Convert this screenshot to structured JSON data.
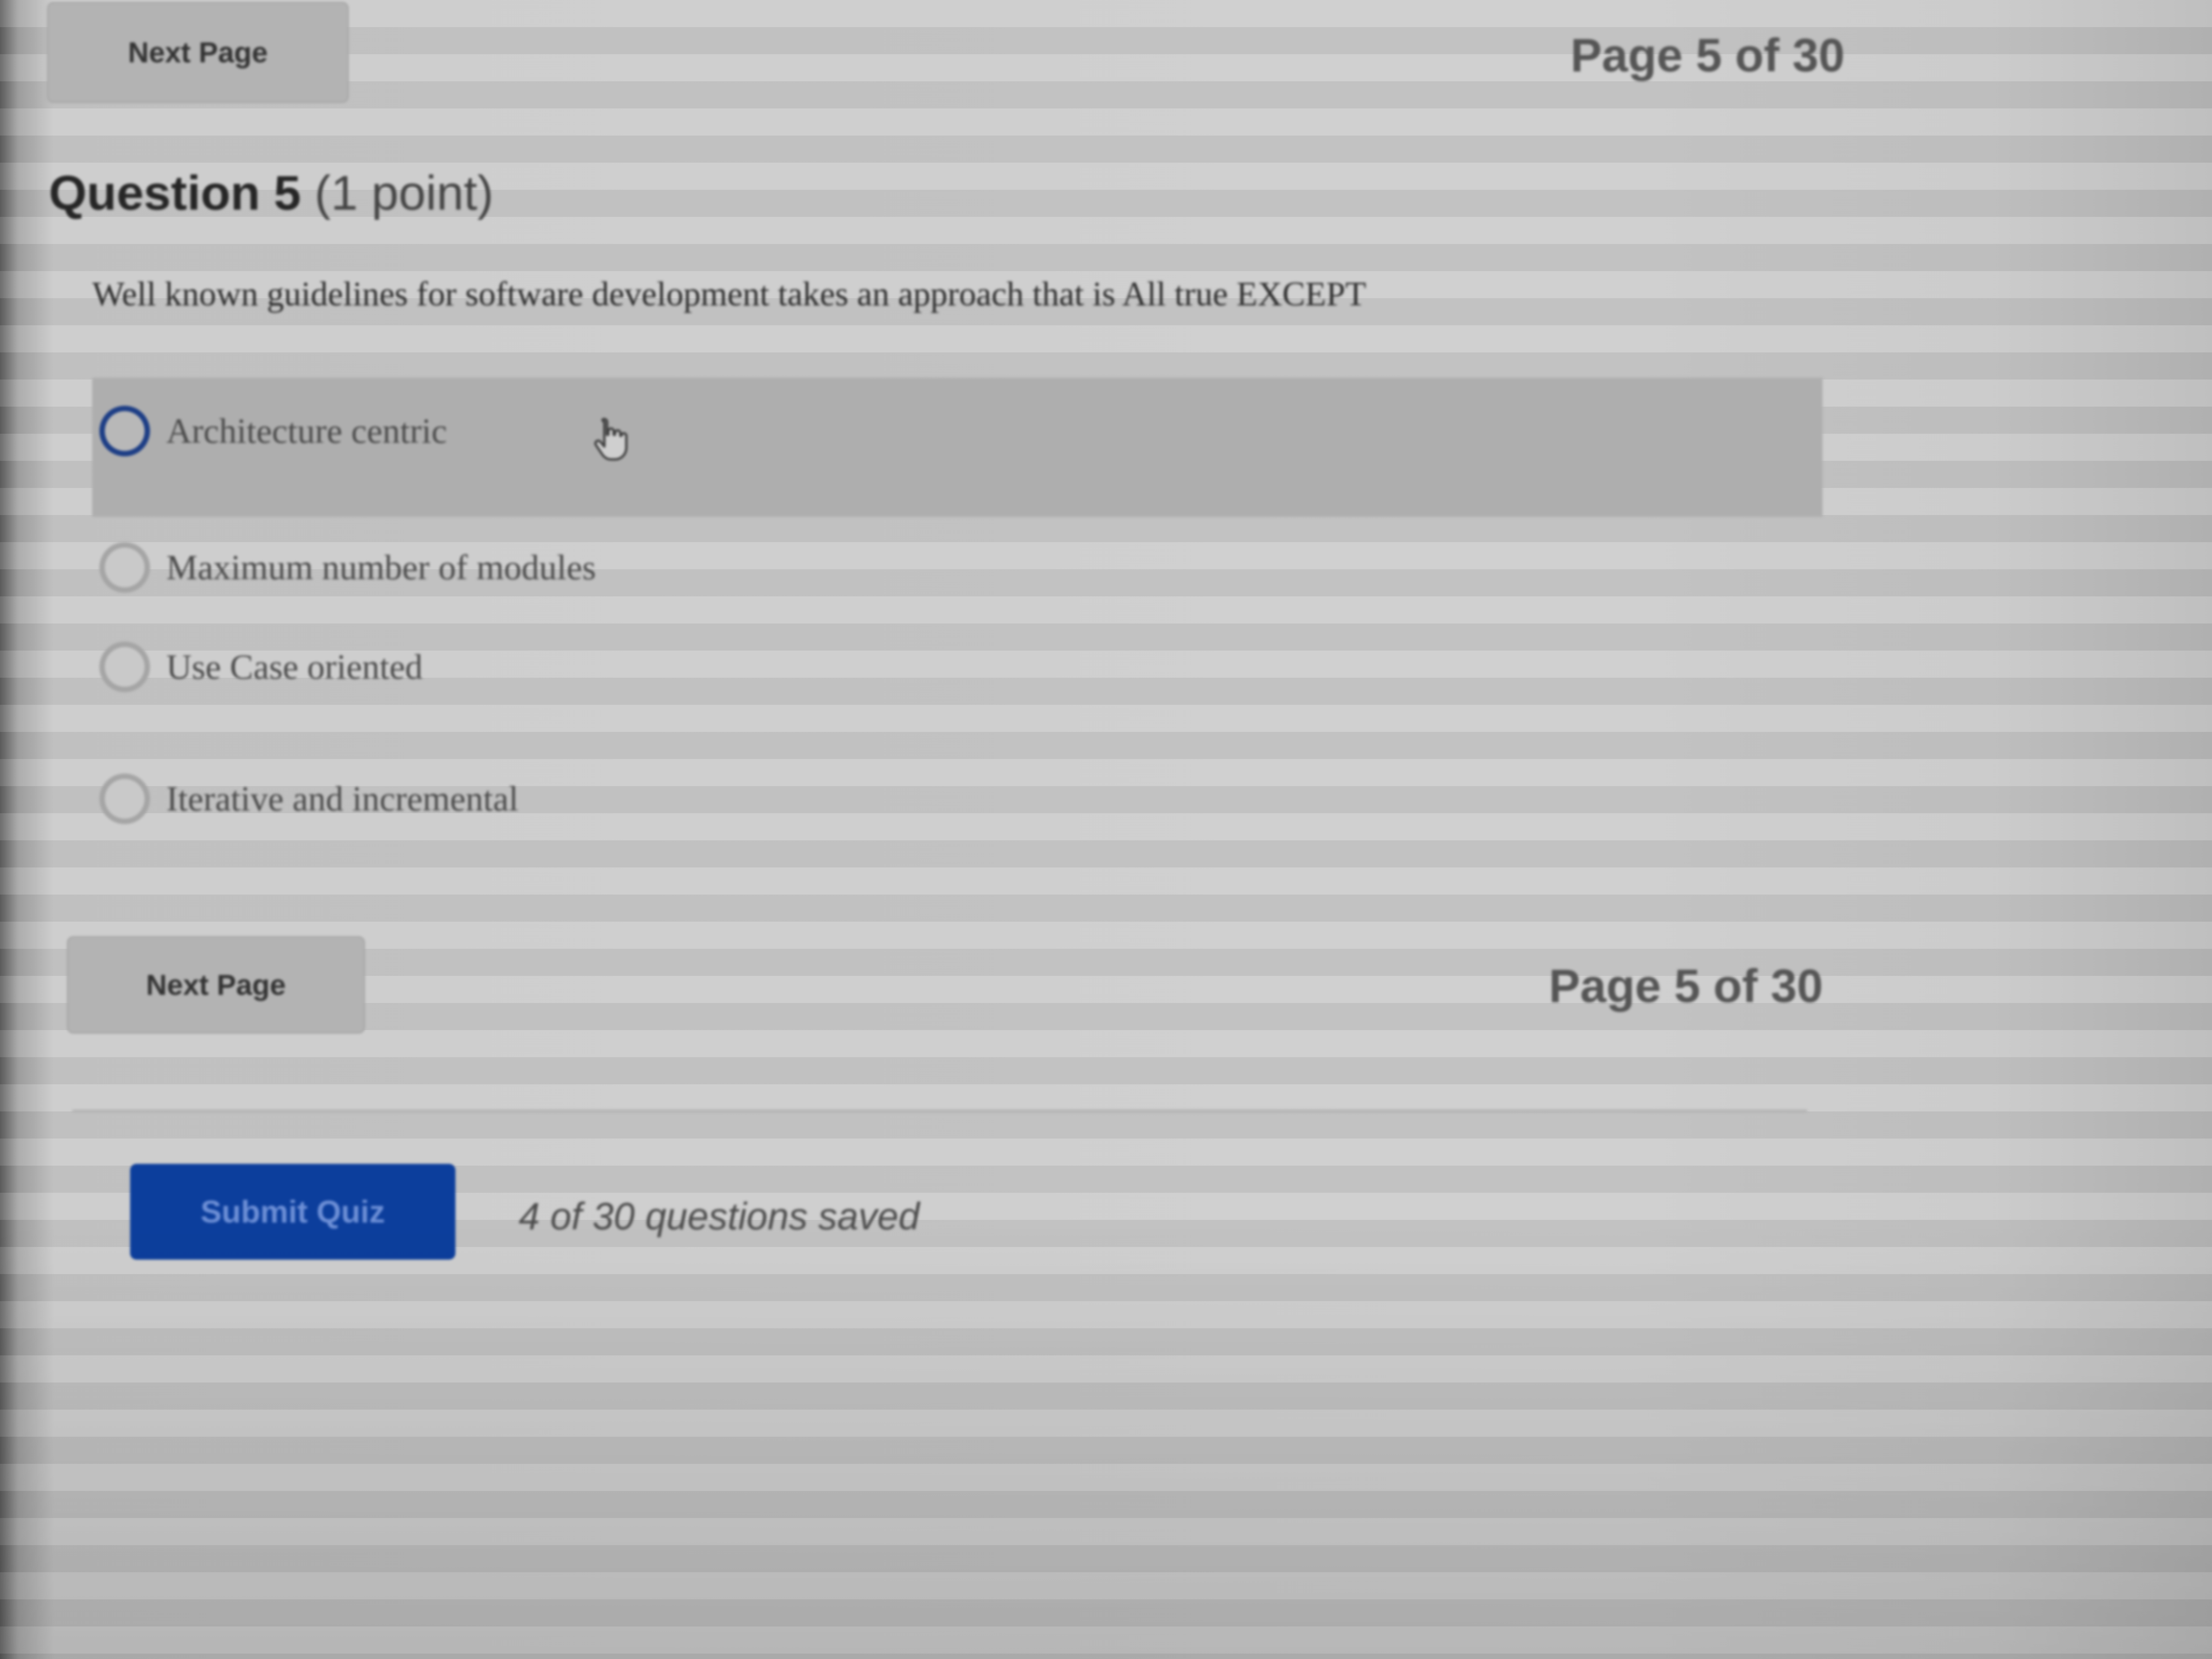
{
  "nav_top": {
    "next_label": "Next Page",
    "page_indicator": "Page 5 of 30"
  },
  "question": {
    "number_label": "Question 5",
    "points_label": "(1 point)",
    "text": "Well known guidelines for software development  takes an approach that is All true EXCEPT"
  },
  "options": [
    {
      "label": "Architecture centric"
    },
    {
      "label": "Maximum number of modules"
    },
    {
      "label": "Use Case oriented"
    },
    {
      "label": "Iterative and incremental"
    }
  ],
  "nav_bottom": {
    "next_label": "Next Page",
    "page_indicator": "Page 5 of 30"
  },
  "footer": {
    "submit_label": "Submit Quiz",
    "saved_status": "4 of 30 questions saved"
  },
  "colors": {
    "accent": "#0c3e9c",
    "radio_focus": "#1d3e86"
  },
  "icons": {
    "cursor": "hand-pointer-icon"
  }
}
